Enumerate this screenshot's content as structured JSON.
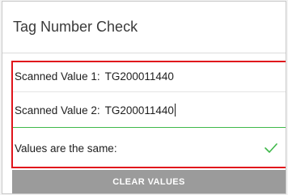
{
  "header": {
    "title": "Tag Number Check"
  },
  "fields": [
    {
      "label": "Scanned Value 1:",
      "value": "TG200011440"
    },
    {
      "label": "Scanned Value 2:",
      "value": "TG200011440"
    }
  ],
  "result": {
    "label": "Values are the same:",
    "icon": "check-icon",
    "color": "#3fb84a"
  },
  "button": {
    "label": "CLEAR VALUES"
  },
  "highlight_color": "#e0151c"
}
